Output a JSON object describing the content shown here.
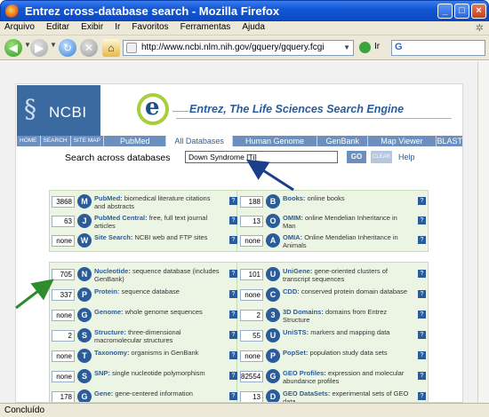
{
  "window": {
    "title": "Entrez cross-database search - Mozilla Firefox"
  },
  "menu": [
    "Arquivo",
    "Editar",
    "Exibir",
    "Ir",
    "Favoritos",
    "Ferramentas",
    "Ajuda"
  ],
  "toolbar": {
    "url": "http://www.ncbi.nlm.nih.gov/gquery/gquery.fcgi",
    "go_label": "Ir"
  },
  "header": {
    "logo_text": "NCBI",
    "e_letter": "e",
    "title": "Entrez, The Life Sciences Search Engine"
  },
  "nav": {
    "subtabs": [
      "HOME",
      "SEARCH",
      "SITE MAP"
    ],
    "tabs": [
      "PubMed",
      "All Databases",
      "Human Genome",
      "GenBank",
      "Map Viewer",
      "BLAST"
    ]
  },
  "search": {
    "label": "Search across databases",
    "value": "Down Syndrome [Ti]",
    "go": "GO",
    "clear": "CLEAR",
    "help": "Help"
  },
  "panel1": {
    "left": [
      {
        "count": "3868",
        "name": "PubMed:",
        "desc": "biomedical literature citations and abstracts",
        "icon": "M"
      },
      {
        "count": "63",
        "name": "PubMed Central:",
        "desc": "free, full text journal articles",
        "icon": "J"
      },
      {
        "count": "none",
        "name": "Site Search:",
        "desc": "NCBI web and FTP sites",
        "icon": "W"
      }
    ],
    "right": [
      {
        "count": "188",
        "name": "Books:",
        "desc": "online books",
        "icon": "B"
      },
      {
        "count": "13",
        "name": "OMIM:",
        "desc": "online Mendelian Inheritance in Man",
        "icon": "O"
      },
      {
        "count": "none",
        "name": "OMIA:",
        "desc": "Online Mendelian Inheritance in Animals",
        "icon": "A"
      }
    ]
  },
  "panel2": {
    "left": [
      {
        "count": "705",
        "name": "Nucleotide:",
        "desc": "sequence database (includes GenBank)",
        "icon": "N"
      },
      {
        "count": "337",
        "name": "Protein:",
        "desc": "sequence database",
        "icon": "P"
      },
      {
        "count": "none",
        "name": "Genome:",
        "desc": "whole genome sequences",
        "icon": "G"
      },
      {
        "count": "2",
        "name": "Structure:",
        "desc": "three-dimensional macromolecular structures",
        "icon": "S"
      },
      {
        "count": "none",
        "name": "Taxonomy:",
        "desc": "organisms in GenBank",
        "icon": "T"
      },
      {
        "count": "none",
        "name": "SNP:",
        "desc": "single nucleotide polymorphism",
        "icon": "S"
      },
      {
        "count": "178",
        "name": "Gene:",
        "desc": "gene-centered information",
        "icon": "G"
      }
    ],
    "right": [
      {
        "count": "101",
        "name": "UniGene:",
        "desc": "gene-oriented clusters of transcript sequences",
        "icon": "U"
      },
      {
        "count": "none",
        "name": "CDD:",
        "desc": "conserved protein domain database",
        "icon": "C"
      },
      {
        "count": "2",
        "name": "3D Domains:",
        "desc": "domains from Entrez Structure",
        "icon": "3"
      },
      {
        "count": "55",
        "name": "UniSTS:",
        "desc": "markers and mapping data",
        "icon": "U"
      },
      {
        "count": "none",
        "name": "PopSet:",
        "desc": "population study data sets",
        "icon": "P"
      },
      {
        "count": "82554",
        "name": "GEO Profiles:",
        "desc": "expression and molecular abundance profiles",
        "icon": "G"
      },
      {
        "count": "13",
        "name": "GEO DataSets:",
        "desc": "experimental sets of GEO data",
        "icon": "D"
      }
    ]
  },
  "status": {
    "text": "Concluído"
  },
  "colors": {
    "accent": "#2a5c9a",
    "panel_bg": "#ecf5e4",
    "arrow_blue": "#1b3f8a",
    "arrow_green": "#2e8b2e"
  }
}
